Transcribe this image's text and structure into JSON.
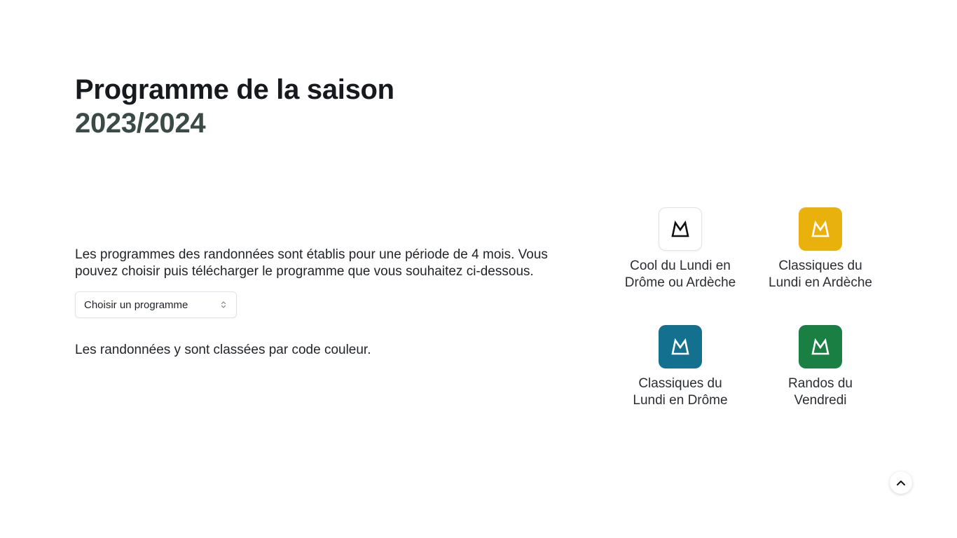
{
  "header": {
    "title_line1": "Programme de la saison",
    "title_line2": "2023/2024"
  },
  "intro_text": "Les programmes des randonnées sont établis pour une période de 4 mois. Vous pouvez choisir puis télécharger le programme que vous souhaitez ci-dessous.",
  "program_select": {
    "selected": "Choisir un programme"
  },
  "outro_text": "Les randonnées y sont classées par code couleur.",
  "legend": [
    {
      "label": "Cool du Lundi en Drôme ou Ardèche",
      "color": "#ffffff",
      "icon": "mountain-icon"
    },
    {
      "label": "Classiques du Lundi en Ardèche",
      "color": "#e9b10c",
      "icon": "mountain-icon"
    },
    {
      "label": "Classiques du Lundi en Drôme",
      "color": "#13718f",
      "icon": "mountain-icon"
    },
    {
      "label": "Randos du Vendredi",
      "color": "#1a7f42",
      "icon": "mountain-icon"
    }
  ],
  "scroll_top": {
    "icon": "chevron-up-icon"
  }
}
